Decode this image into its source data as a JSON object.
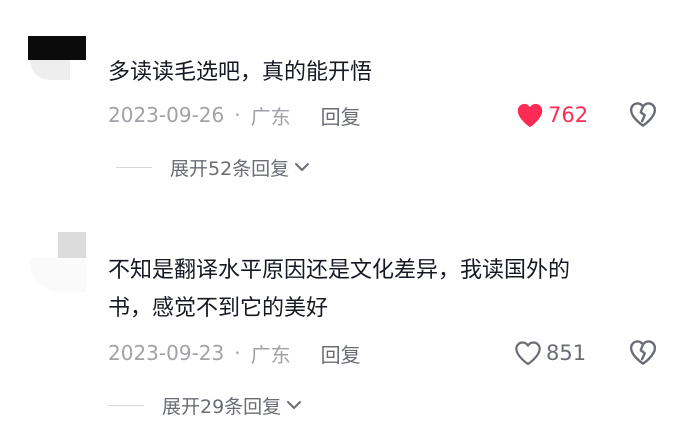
{
  "comments": [
    {
      "text": "多读读毛选吧，真的能开悟",
      "date": "2023-09-26",
      "separator": "·",
      "location": "广东",
      "reply_label": "回复",
      "like_count": "762",
      "liked": true,
      "expand_label": "展开52条回复"
    },
    {
      "text": "不知是翻译水平原因还是文化差异，我读国外的\n书，感觉不到它的美好",
      "date": "2023-09-23",
      "separator": "·",
      "location": "广东",
      "reply_label": "回复",
      "like_count": "851",
      "liked": false,
      "expand_label": "展开29条回复"
    }
  ],
  "colors": {
    "liked_red": "#fe2c55",
    "meta_gray": "#a0a2a8",
    "text_dark": "#161823"
  },
  "icons": {
    "like": "heart-icon",
    "dislike": "broken-heart-icon",
    "expand": "chevron-down-icon"
  }
}
